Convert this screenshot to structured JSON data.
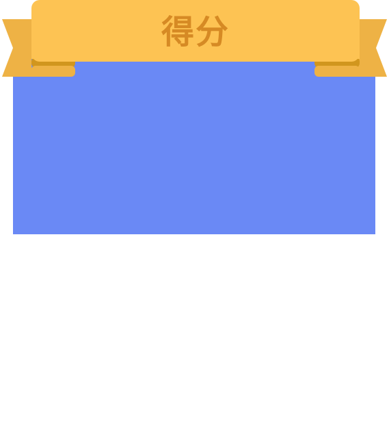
{
  "score_card": {
    "title": "得分"
  },
  "colors": {
    "panel": "#6a89f5",
    "ribbon_front": "#fdc353",
    "ribbon_tail": "#eeb245",
    "ribbon_fold": "#d1961e",
    "title_text": "#d68a24"
  }
}
